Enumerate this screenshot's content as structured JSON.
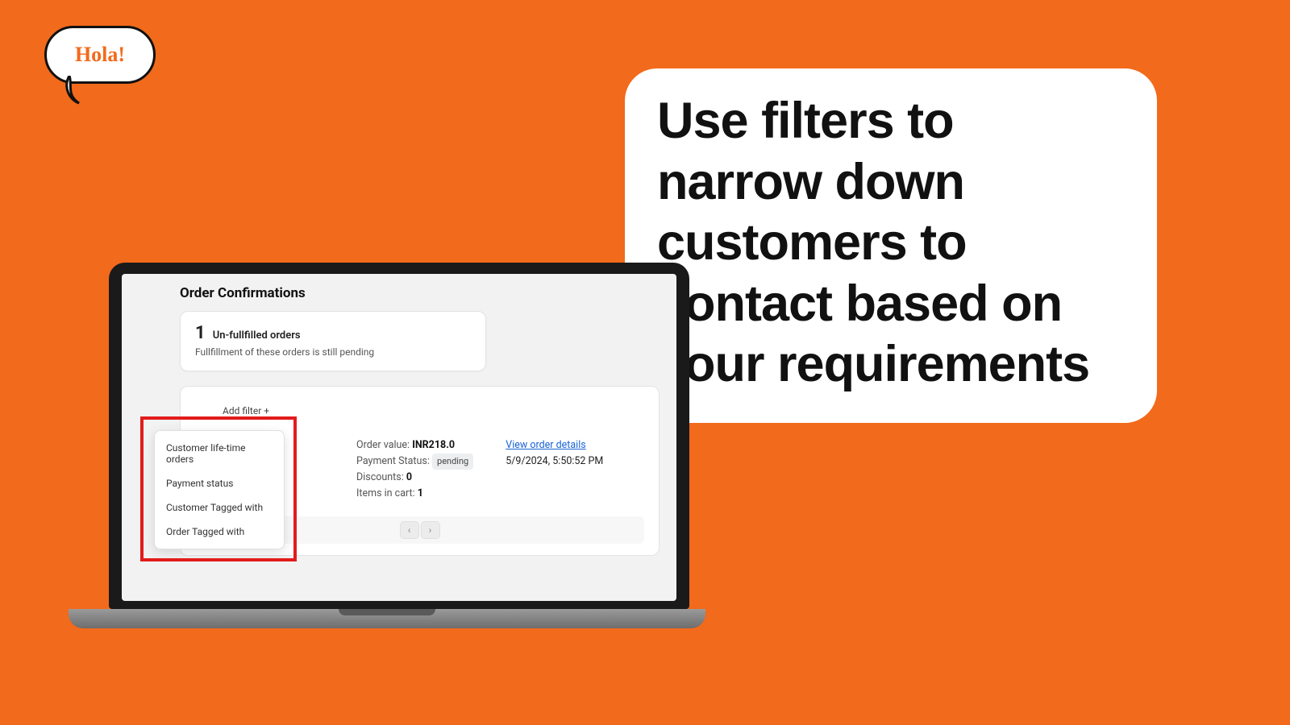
{
  "speech_bubble_text": "Hola!",
  "headline": "Use filters to narrow down customers to contact based on your requirements",
  "app": {
    "page_title": "Order Confirmations",
    "summary": {
      "count": "1",
      "label": "Un-fullfilled orders",
      "subtext": "Fullfillment of these orders is still pending"
    },
    "add_filter_label": "Add filter  +",
    "filter_options": [
      "Customer life-time orders",
      "Payment status",
      "Customer Tagged with",
      "Order Tagged with"
    ],
    "order": {
      "value_label": "Order value:",
      "value": "INR218.0",
      "payment_status_label": "Payment Status:",
      "payment_status_value": "pending",
      "discounts_label": "Discounts:",
      "discounts_value": "0",
      "items_label": "Items in cart:",
      "items_value": "1",
      "view_link": "View order details",
      "timestamp": "5/9/2024, 5:50:52 PM"
    }
  }
}
